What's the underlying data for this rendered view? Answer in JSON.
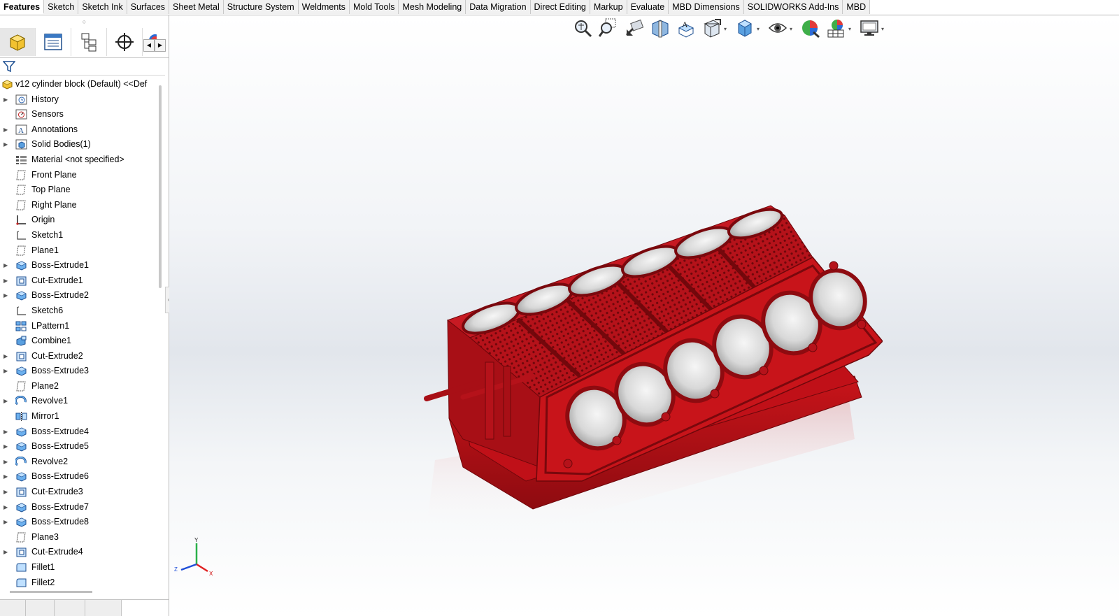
{
  "command_tabs": [
    {
      "label": "Features",
      "active": true
    },
    {
      "label": "Sketch"
    },
    {
      "label": "Sketch Ink"
    },
    {
      "label": "Surfaces"
    },
    {
      "label": "Sheet Metal"
    },
    {
      "label": "Structure System"
    },
    {
      "label": "Weldments"
    },
    {
      "label": "Mold Tools"
    },
    {
      "label": "Mesh Modeling"
    },
    {
      "label": "Data Migration"
    },
    {
      "label": "Direct Editing"
    },
    {
      "label": "Markup"
    },
    {
      "label": "Evaluate"
    },
    {
      "label": "MBD Dimensions"
    },
    {
      "label": "SOLIDWORKS Add-Ins"
    },
    {
      "label": "MBD"
    }
  ],
  "manager_tabs": [
    "featuremanager-icon",
    "propertymanager-icon",
    "configurationmanager-icon",
    "dimxpert-icon",
    "display-manager-icon"
  ],
  "tree": {
    "root": {
      "label": "v12 cylinder block (Default) <<Def",
      "icon": "part-icon"
    },
    "items": [
      {
        "label": "History",
        "icon": "history-icon",
        "expandable": true
      },
      {
        "label": "Sensors",
        "icon": "sensor-icon",
        "expandable": false
      },
      {
        "label": "Annotations",
        "icon": "annotation-icon",
        "expandable": true
      },
      {
        "label": "Solid Bodies(1)",
        "icon": "solid-body-icon",
        "expandable": true
      },
      {
        "label": "Material <not specified>",
        "icon": "material-icon",
        "expandable": false
      },
      {
        "label": "Front Plane",
        "icon": "plane-icon",
        "expandable": false
      },
      {
        "label": "Top Plane",
        "icon": "plane-icon",
        "expandable": false
      },
      {
        "label": "Right Plane",
        "icon": "plane-icon",
        "expandable": false
      },
      {
        "label": "Origin",
        "icon": "origin-icon",
        "expandable": false
      },
      {
        "label": "Sketch1",
        "icon": "sketch-icon",
        "expandable": false
      },
      {
        "label": "Plane1",
        "icon": "plane-icon",
        "expandable": false
      },
      {
        "label": "Boss-Extrude1",
        "icon": "boss-extrude-icon",
        "expandable": true
      },
      {
        "label": "Cut-Extrude1",
        "icon": "cut-extrude-icon",
        "expandable": true
      },
      {
        "label": "Boss-Extrude2",
        "icon": "boss-extrude-icon",
        "expandable": true
      },
      {
        "label": "Sketch6",
        "icon": "sketch-icon",
        "expandable": false
      },
      {
        "label": "LPattern1",
        "icon": "linear-pattern-icon",
        "expandable": false
      },
      {
        "label": "Combine1",
        "icon": "combine-icon",
        "expandable": false
      },
      {
        "label": "Cut-Extrude2",
        "icon": "cut-extrude-icon",
        "expandable": true
      },
      {
        "label": "Boss-Extrude3",
        "icon": "boss-extrude-icon",
        "expandable": true
      },
      {
        "label": "Plane2",
        "icon": "plane-icon",
        "expandable": false
      },
      {
        "label": "Revolve1",
        "icon": "revolve-icon",
        "expandable": true
      },
      {
        "label": "Mirror1",
        "icon": "mirror-icon",
        "expandable": false
      },
      {
        "label": "Boss-Extrude4",
        "icon": "boss-extrude-icon",
        "expandable": true
      },
      {
        "label": "Boss-Extrude5",
        "icon": "boss-extrude-icon",
        "expandable": true
      },
      {
        "label": "Revolve2",
        "icon": "revolve-icon",
        "expandable": true
      },
      {
        "label": "Boss-Extrude6",
        "icon": "boss-extrude-icon",
        "expandable": true
      },
      {
        "label": "Cut-Extrude3",
        "icon": "cut-extrude-icon",
        "expandable": true
      },
      {
        "label": "Boss-Extrude7",
        "icon": "boss-extrude-icon",
        "expandable": true
      },
      {
        "label": "Boss-Extrude8",
        "icon": "boss-extrude-icon",
        "expandable": true
      },
      {
        "label": "Plane3",
        "icon": "plane-icon",
        "expandable": false
      },
      {
        "label": "Cut-Extrude4",
        "icon": "cut-extrude-icon",
        "expandable": true
      },
      {
        "label": "Fillet1",
        "icon": "fillet-icon",
        "expandable": false
      },
      {
        "label": "Fillet2",
        "icon": "fillet-icon",
        "expandable": false
      }
    ]
  },
  "heads_up_toolbar": [
    {
      "name": "zoom-to-fit-icon",
      "dropdown": false
    },
    {
      "name": "zoom-to-area-icon",
      "dropdown": false
    },
    {
      "name": "previous-view-icon",
      "dropdown": false
    },
    {
      "name": "section-view-icon",
      "dropdown": false
    },
    {
      "name": "dynamic-annotation-views-icon",
      "dropdown": false
    },
    {
      "name": "view-orientation-icon",
      "dropdown": true
    },
    {
      "name": "display-style-icon",
      "dropdown": true
    },
    {
      "name": "hide-show-items-icon",
      "dropdown": true
    },
    {
      "name": "edit-appearance-icon",
      "dropdown": false
    },
    {
      "name": "apply-scene-icon",
      "dropdown": true
    },
    {
      "name": "view-settings-icon",
      "dropdown": true
    }
  ],
  "triad": {
    "x_label": "X",
    "y_label": "Y",
    "z_label": "Z"
  },
  "colors": {
    "model_red": "#c8141a",
    "model_dark": "#8e0b10",
    "bore_steel": "#e6e6e6",
    "accent_tab": "#ffffff"
  }
}
